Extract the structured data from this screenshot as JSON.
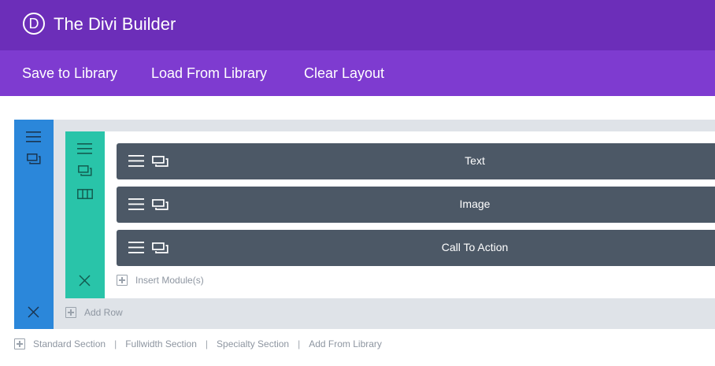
{
  "header": {
    "logo_letter": "D",
    "title": "The Divi Builder",
    "background": "#6c2eb9"
  },
  "toolbar": {
    "save_label": "Save to Library",
    "load_label": "Load From Library",
    "clear_label": "Clear Layout",
    "background": "#7e3bd0"
  },
  "section": {
    "color": "#2b87da",
    "icons": [
      "menu-icon",
      "duplicate-icon",
      "close-icon"
    ],
    "add_row_label": "Add Row"
  },
  "row": {
    "color": "#29c4a9",
    "icons": [
      "menu-icon",
      "duplicate-icon",
      "columns-icon",
      "close-icon"
    ],
    "insert_label": "Insert Module(s)"
  },
  "modules": [
    {
      "label": "Text"
    },
    {
      "label": "Image"
    },
    {
      "label": "Call To Action"
    }
  ],
  "module_color": "#4c5866",
  "footer": {
    "standard": "Standard Section",
    "fullwidth": "Fullwidth Section",
    "specialty": "Specialty Section",
    "library": "Add From Library",
    "separator": "|"
  }
}
